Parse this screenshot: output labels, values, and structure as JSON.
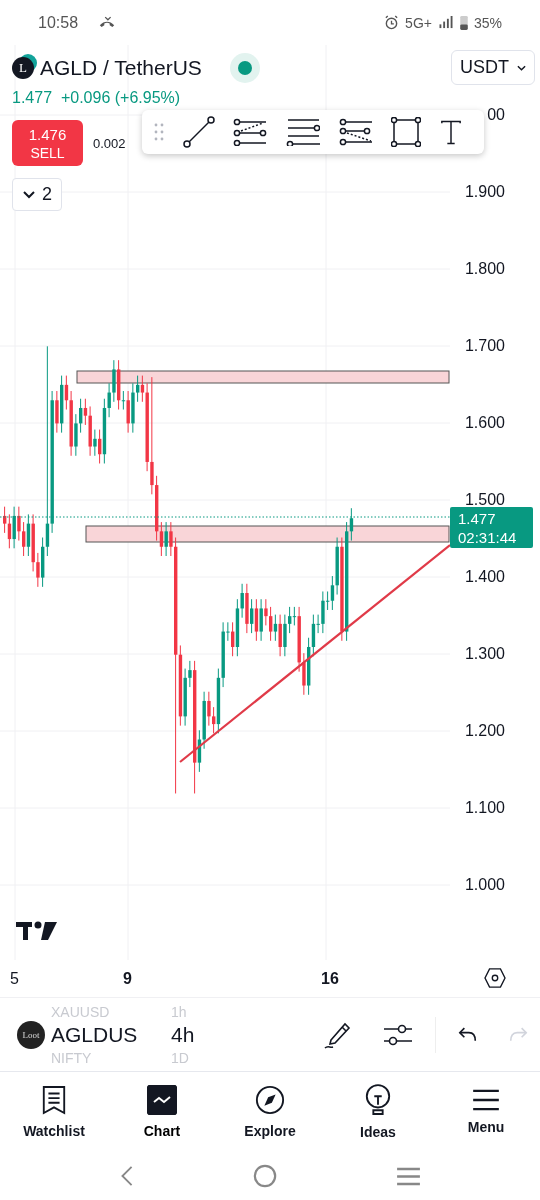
{
  "status_bar": {
    "time": "10:58",
    "network": "5G+",
    "battery": "35%"
  },
  "header": {
    "logo_letter": "L",
    "symbol": "AGLD / TetherUS",
    "currency": "USDT",
    "last": "1.477",
    "change": "+0.096 (+6.95%)",
    "sell": {
      "price": "1.476",
      "label": "SELL"
    },
    "spread": "0.002",
    "collapse_count": "2"
  },
  "drawing_toolbar": {
    "tools": [
      {
        "kind": "trend"
      },
      {
        "kind": "fib"
      },
      {
        "kind": "parallel"
      },
      {
        "kind": "pitchfork"
      },
      {
        "kind": "rectangle"
      },
      {
        "kind": "text"
      }
    ]
  },
  "price_axis": {
    "labels": [
      "00",
      "1.900",
      "1.800",
      "1.700",
      "1.600",
      "1.500",
      "1.400",
      "1.300",
      "1.200",
      "1.100",
      "1.000"
    ]
  },
  "price_tag": {
    "price": "1.477",
    "countdown": "02:31:44"
  },
  "date_axis": {
    "labels": [
      "5",
      "9",
      "16"
    ]
  },
  "symbol_picker": {
    "logo_text": "Loot",
    "rows": [
      {
        "symbol": "XAUUSD",
        "interval": "1h",
        "selected": false
      },
      {
        "symbol": "AGLDUS",
        "interval": "4h",
        "selected": true
      },
      {
        "symbol": "NIFTY",
        "interval": "1D",
        "selected": false
      }
    ]
  },
  "tab_bar": [
    {
      "kind": "watchlist",
      "label": "Watchlist",
      "selected": false
    },
    {
      "kind": "chart",
      "label": "Chart",
      "selected": true
    },
    {
      "kind": "explore",
      "label": "Explore",
      "selected": false
    },
    {
      "kind": "ideas",
      "label": "Ideas",
      "selected": false
    },
    {
      "kind": "menu",
      "label": "Menu",
      "selected": false
    }
  ]
}
